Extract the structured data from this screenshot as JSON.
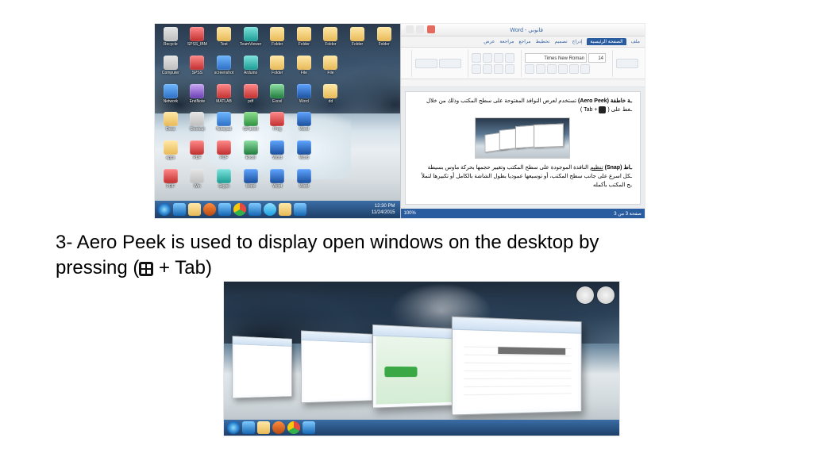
{
  "caption": {
    "line1": "3- Aero Peek is used to display open windows on the desktop by",
    "line2_prefix": "pressing (",
    "line2_suffix": " + Tab)"
  },
  "desktop": {
    "icons": [
      {
        "label": "Recycle",
        "style": "c-grey"
      },
      {
        "label": "SPSS_IBM",
        "style": "c-red"
      },
      {
        "label": "Test",
        "style": "c-folder"
      },
      {
        "label": "TeamViewer",
        "style": "c-teal"
      },
      {
        "label": "Folder",
        "style": "c-folder"
      },
      {
        "label": "Folder",
        "style": "c-folder"
      },
      {
        "label": "Folder",
        "style": "c-folder"
      },
      {
        "label": "Folder",
        "style": "c-folder"
      },
      {
        "label": "Folder",
        "style": "c-folder"
      },
      {
        "label": "Computer",
        "style": "c-grey"
      },
      {
        "label": "SPSS",
        "style": "c-red"
      },
      {
        "label": "screenshot",
        "style": "c-blue"
      },
      {
        "label": "Arduino",
        "style": "c-teal"
      },
      {
        "label": "Folder",
        "style": "c-folder"
      },
      {
        "label": "File",
        "style": "c-folder"
      },
      {
        "label": "File",
        "style": "c-folder"
      },
      {
        "label": "",
        "style": ""
      },
      {
        "label": "",
        "style": ""
      },
      {
        "label": "Network",
        "style": "c-blue"
      },
      {
        "label": "EndNote",
        "style": "c-purple"
      },
      {
        "label": "MATLAB",
        "style": "c-red"
      },
      {
        "label": "pdf",
        "style": "c-red"
      },
      {
        "label": "Excel",
        "style": "c-excel"
      },
      {
        "label": "Word",
        "style": "c-word"
      },
      {
        "label": "dd",
        "style": "c-folder"
      },
      {
        "label": "",
        "style": ""
      },
      {
        "label": "",
        "style": ""
      },
      {
        "label": "Docs",
        "style": "c-folder"
      },
      {
        "label": "Shortcut",
        "style": "c-grey"
      },
      {
        "label": "Notepad",
        "style": "c-blue"
      },
      {
        "label": "GParted",
        "style": "c-green"
      },
      {
        "label": "Prog",
        "style": "c-red"
      },
      {
        "label": "Word",
        "style": "c-word"
      },
      {
        "label": "",
        "style": ""
      },
      {
        "label": "",
        "style": ""
      },
      {
        "label": "",
        "style": ""
      },
      {
        "label": "apps",
        "style": "c-folder"
      },
      {
        "label": "PDF",
        "style": "c-red"
      },
      {
        "label": "PDF",
        "style": "c-red"
      },
      {
        "label": "Excel",
        "style": "c-excel"
      },
      {
        "label": "Word",
        "style": "c-word"
      },
      {
        "label": "Word",
        "style": "c-word"
      },
      {
        "label": "",
        "style": ""
      },
      {
        "label": "",
        "style": ""
      },
      {
        "label": "",
        "style": ""
      },
      {
        "label": "PDF",
        "style": "c-red"
      },
      {
        "label": "Win",
        "style": "c-grey"
      },
      {
        "label": "Skype",
        "style": "c-teal"
      },
      {
        "label": "Word",
        "style": "c-word"
      },
      {
        "label": "Word",
        "style": "c-word"
      },
      {
        "label": "Word",
        "style": "c-word"
      },
      {
        "label": "",
        "style": ""
      },
      {
        "label": "",
        "style": ""
      },
      {
        "label": "",
        "style": ""
      }
    ],
    "clock": {
      "time": "12:30 PM",
      "date": "11/24/2015"
    }
  },
  "word": {
    "title": "Word - قانوني",
    "tabs": [
      "ملف",
      "الصفحة الرئيسية",
      "إدراج",
      "تصميم",
      "تخطيط",
      "مراجع",
      "مراجعة",
      "عرض"
    ],
    "font_name": "Times New Roman",
    "font_size": "14",
    "doc": {
      "para1_lead": "ـة خاطفة (Aero Peek)",
      "para1_rest": " تستخدم لعرض النوافذ المفتوحة على سطح المكتب وذلك من خلال",
      "para1_keys_after": " + Tab )",
      "para1_keys_before": "ـغط على ( ",
      "para2_lead": "ـاط (Snap) ",
      "para2_u": "تنظيم",
      "para2_rest": " النافذة الموجودة على سطح المكتب وتغيير حجمها بحركة ماوس بسيطة",
      "para3": "ـكل اسرع على جانب سطح المكتب، أو توسيعها عموديا بطول الشاشة بالكامل أو تكبيرها لتملأ",
      "para4": "ـح المكتب بأكمله"
    },
    "status_left": "صفحة 3 من 3",
    "status_right": "100%"
  }
}
